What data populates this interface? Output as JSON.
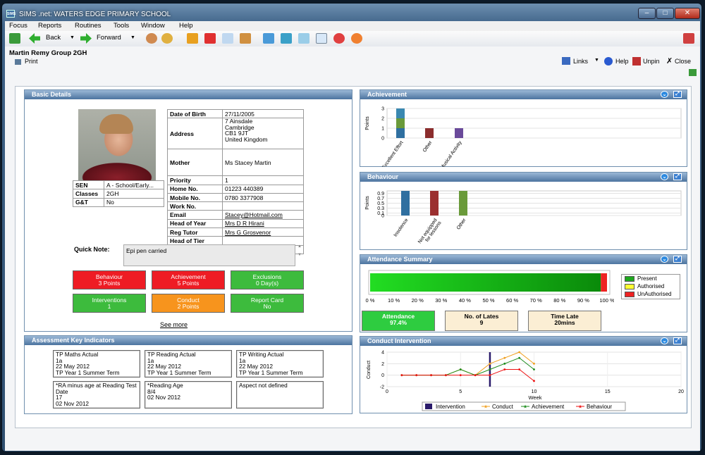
{
  "window": {
    "title": "SIMS .net: WATERS EDGE PRIMARY SCHOOL",
    "app_icon": "SIMS"
  },
  "menu": [
    "Focus",
    "Reports",
    "Routines",
    "Tools",
    "Window",
    "Help"
  ],
  "toolbar": {
    "back_label": "Back",
    "forward_label": "Forward"
  },
  "student": {
    "header": "Martin Remy  Group 2GH"
  },
  "commands": {
    "print": "Print",
    "links": "Links",
    "help": "Help",
    "unpin": "Unpin",
    "close": "Close"
  },
  "basic": {
    "title": "Basic Details",
    "left_rows": [
      {
        "k": "SEN",
        "v": "A - School/Early..."
      },
      {
        "k": "Classes",
        "v": "2GH"
      },
      {
        "k": "G&T",
        "v": "No"
      }
    ],
    "right_rows": [
      {
        "k": "Date of Birth",
        "v": "27/11/2005"
      },
      {
        "k": "Address",
        "v": "7 Ainsdale\nCambridge\nCB1 9JT\nUnited Kingdom"
      },
      {
        "k": "Mother",
        "v": "Ms Stacey Martin"
      },
      {
        "k": "Priority",
        "v": "1"
      },
      {
        "k": "Home No.",
        "v": "01223 440389"
      },
      {
        "k": "Mobile No.",
        "v": "0780 3377908"
      },
      {
        "k": "Work No.",
        "v": ""
      },
      {
        "k": "Email",
        "v": "Stacey@Hotmail.com",
        "link": true
      },
      {
        "k": "Head of Year",
        "v": "Mrs D R Hirani",
        "link": true
      },
      {
        "k": "Reg Tutor",
        "v": "Mrs G Grosvenor",
        "link": true
      },
      {
        "k": "Head of Tier",
        "v": ""
      },
      {
        "k": "Head of House",
        "v": ""
      }
    ],
    "quick_note_label": "Quick Note:",
    "quick_note": "Epi pen carried",
    "tiles": [
      {
        "t": "Behaviour",
        "s": "3 Points",
        "c": "#ee1c24"
      },
      {
        "t": "Achievement",
        "s": "5 Points",
        "c": "#ee1c24"
      },
      {
        "t": "Exclusions",
        "s": "0 Day(s)",
        "c": "#3dbb3d"
      },
      {
        "t": "Interventions",
        "s": "1",
        "c": "#3dbb3d"
      },
      {
        "t": "Conduct",
        "s": "2 Points",
        "c": "#f7941d"
      },
      {
        "t": "Report Card",
        "s": "No",
        "c": "#3dbb3d"
      }
    ],
    "see_more": "See more"
  },
  "ak": {
    "title": "Assessment Key Indicators",
    "boxes": [
      "TP Maths Actual\n1a\n22 May 2012\nTP Year 1 Summer Term",
      "TP Reading Actual\n1a\n22 May 2012\nTP Year 1 Summer Term",
      "TP Writing Actual\n1a\n22 May 2012\nTP Year 1 Summer Term",
      "*RA minus age at Reading Test Date\n17\n02 Nov 2012",
      "*Reading Age\n8/4\n02 Nov 2012",
      "Aspect not defined"
    ]
  },
  "achievement": {
    "title": "Achievement",
    "ylabel": "Points"
  },
  "behaviour": {
    "title": "Behaviour",
    "ylabel": "Points"
  },
  "attendance": {
    "title": "Attendance Summary",
    "legend": [
      {
        "n": "Present",
        "c": "#1ea81e"
      },
      {
        "n": "Authorised",
        "c": "#ffff33"
      },
      {
        "n": "UnAuthorised",
        "c": "#ee2222"
      }
    ],
    "ticks": [
      "0 %",
      "10 %",
      "20 %",
      "30 %",
      "40 %",
      "50 %",
      "60 %",
      "70 %",
      "80 %",
      "90 %",
      "100 %"
    ],
    "summary": [
      {
        "t": "Attendance",
        "v": "97.4%",
        "c": "#2ecc40"
      },
      {
        "t": "No. of Lates",
        "v": "9",
        "c": "#fbeed4"
      },
      {
        "t": "Time Late",
        "v": "20mins",
        "c": "#fbeed4"
      }
    ]
  },
  "conduct": {
    "title": "Conduct Intervention",
    "ylabel": "Conduct",
    "xlabel": "Week",
    "legend": [
      "Intervention",
      "Conduct",
      "Achievement",
      "Behaviour"
    ]
  },
  "chart_data": [
    {
      "type": "bar",
      "title": "Achievement",
      "ylabel": "Points",
      "ylim": [
        0,
        3
      ],
      "categories": [
        "Excellent Effort",
        "Other",
        "Musical Activity"
      ],
      "series": [
        {
          "values": [
            1,
            0,
            0
          ],
          "color": "#2f6fa0"
        },
        {
          "values": [
            1,
            0,
            0
          ],
          "color": "#6a9a3a"
        },
        {
          "values": [
            1,
            1,
            1
          ],
          "color": "#3a88b0"
        }
      ],
      "colors": [
        "#2f6fa0",
        "#8b2d2d",
        "#6a4a9a"
      ]
    },
    {
      "type": "bar",
      "title": "Behaviour",
      "ylabel": "Points",
      "ylim": [
        0,
        1
      ],
      "categories": [
        "Insolence",
        "Not equipped for lessons",
        "Other"
      ],
      "values": [
        1,
        1,
        1
      ],
      "colors": [
        "#2f6fa0",
        "#9b2f2f",
        "#6a9a3a"
      ]
    },
    {
      "type": "bar",
      "title": "Attendance Summary",
      "orientation": "horizontal",
      "values": {
        "Present": 97.4,
        "Authorised": 0,
        "UnAuthorised": 2.6
      },
      "xlim": [
        0,
        100
      ]
    },
    {
      "type": "line",
      "title": "Conduct Intervention",
      "xlabel": "Week",
      "ylabel": "Conduct",
      "xlim": [
        0,
        20
      ],
      "ylim": [
        -2,
        4
      ],
      "intervention_x": 7,
      "series": [
        {
          "name": "Conduct",
          "color": "#f0a020",
          "x": [
            1,
            2,
            3,
            4,
            5,
            6,
            7,
            8,
            9,
            10
          ],
          "y": [
            0,
            0,
            0,
            0,
            1,
            0,
            2,
            3,
            4,
            2
          ]
        },
        {
          "name": "Achievement",
          "color": "#1a8a1a",
          "x": [
            1,
            2,
            3,
            4,
            5,
            6,
            7,
            8,
            9,
            10
          ],
          "y": [
            0,
            0,
            0,
            0,
            1,
            0,
            1,
            2,
            3,
            1
          ]
        },
        {
          "name": "Behaviour",
          "color": "#ee1111",
          "x": [
            1,
            2,
            3,
            4,
            5,
            6,
            7,
            8,
            9,
            10
          ],
          "y": [
            0,
            0,
            0,
            0,
            0,
            0,
            0,
            1,
            1,
            -1
          ]
        }
      ]
    }
  ]
}
